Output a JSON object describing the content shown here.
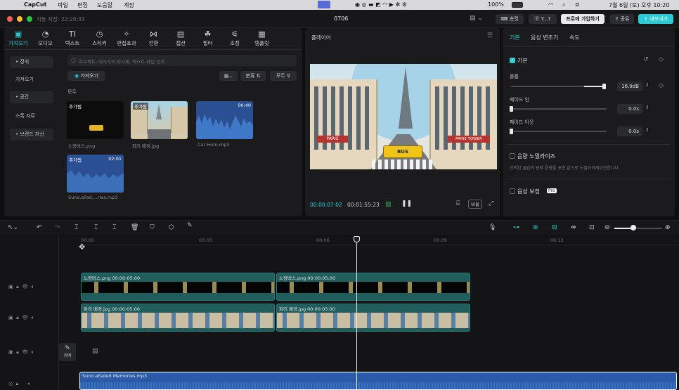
{
  "menubar": {
    "app": "CapCut",
    "items": [
      "파일",
      "편집",
      "도움말",
      "계정"
    ],
    "battery": "100%",
    "clock": "7월 6일 (토) 오후 10:20"
  },
  "titlebar": {
    "autosave": "자동 저장: 22:20:33",
    "project": "0706",
    "shortcut": "숏컷",
    "user": "Y...7",
    "pro": "프로에 가입하기",
    "share": "공유",
    "export": "내보내기"
  },
  "toolbar": {
    "tabs": [
      {
        "label": "가져오기",
        "icon": "▣"
      },
      {
        "label": "오디오",
        "icon": "◔"
      },
      {
        "label": "텍스트",
        "icon": "TI"
      },
      {
        "label": "스티커",
        "icon": "◷"
      },
      {
        "label": "편집효과",
        "icon": "✧"
      },
      {
        "label": "전환",
        "icon": "⋈"
      },
      {
        "label": "캡션",
        "icon": "▤"
      },
      {
        "label": "필터",
        "icon": "☘"
      },
      {
        "label": "조정",
        "icon": "⚟"
      },
      {
        "label": "템플릿",
        "icon": "▦"
      }
    ]
  },
  "sidebar": {
    "items": [
      "• 장치",
      "가져오기",
      "• 공간",
      "스톡 자료",
      "• 브랜드 자산"
    ]
  },
  "media": {
    "search_placeholder": "프로젝트, 이미지의 피사체, 텍스트 라인 검색",
    "import": "가져오기",
    "sort": "분류",
    "all_filter": "모두",
    "section": "모두",
    "items": [
      {
        "name": "노랑버스.png",
        "badge": "추가됨",
        "duration": ""
      },
      {
        "name": "파리 배경.jpg",
        "badge": "추가됨",
        "duration": ""
      },
      {
        "name": "Car Horn.mp3",
        "badge": "",
        "duration": "00:40"
      },
      {
        "name": "Suno.aFad....ries.mp3",
        "badge": "추가됨",
        "duration": "02:01"
      }
    ]
  },
  "player": {
    "title": "플레이어",
    "current": "00:00:07:02",
    "total": "00:01:55:23",
    "ratio": "비율",
    "bus_text": "BUS",
    "paris_text": "PARIS",
    "tower_text": "PARIS TOWER"
  },
  "inspector": {
    "tabs": [
      "기본",
      "음성 변조기",
      "속도"
    ],
    "section": "기본",
    "volume_label": "볼륨",
    "volume_value": "16.9dB",
    "volume_level": 0.88,
    "fade_in_label": "페이드 인",
    "fade_in_value": "0.0s",
    "fade_out_label": "페이드 아웃",
    "fade_out_value": "0.0s",
    "normalize_label": "음량 노멀라이즈",
    "normalize_desc": "선택한 클립의 원래 음량을 표준 값으로 노멀라이제이션합니다.",
    "enhance_label": "음성 보정",
    "pro_badge": "Pro"
  },
  "timeline": {
    "ruler": [
      "00:00",
      "00:03",
      "00:06",
      "00:09",
      "00:12"
    ],
    "tracks": [
      {
        "clips": [
          {
            "label": "노랑버스.png  00:00:05:00"
          },
          {
            "label": "노랑버스.png  00:00:05:00"
          }
        ]
      },
      {
        "clips": [
          {
            "label": "파리 배경.jpg  00:00:05:00"
          },
          {
            "label": "파리 배경.jpg  00:00:05:00"
          }
        ]
      }
    ],
    "cover": "커버",
    "audio_clip": "Suno.aFaded Memories.mp3"
  },
  "colors": {
    "accent": "#2ccbd3",
    "clip_teal": "#1f5e5c",
    "audio_blue": "#2a5aa8"
  }
}
